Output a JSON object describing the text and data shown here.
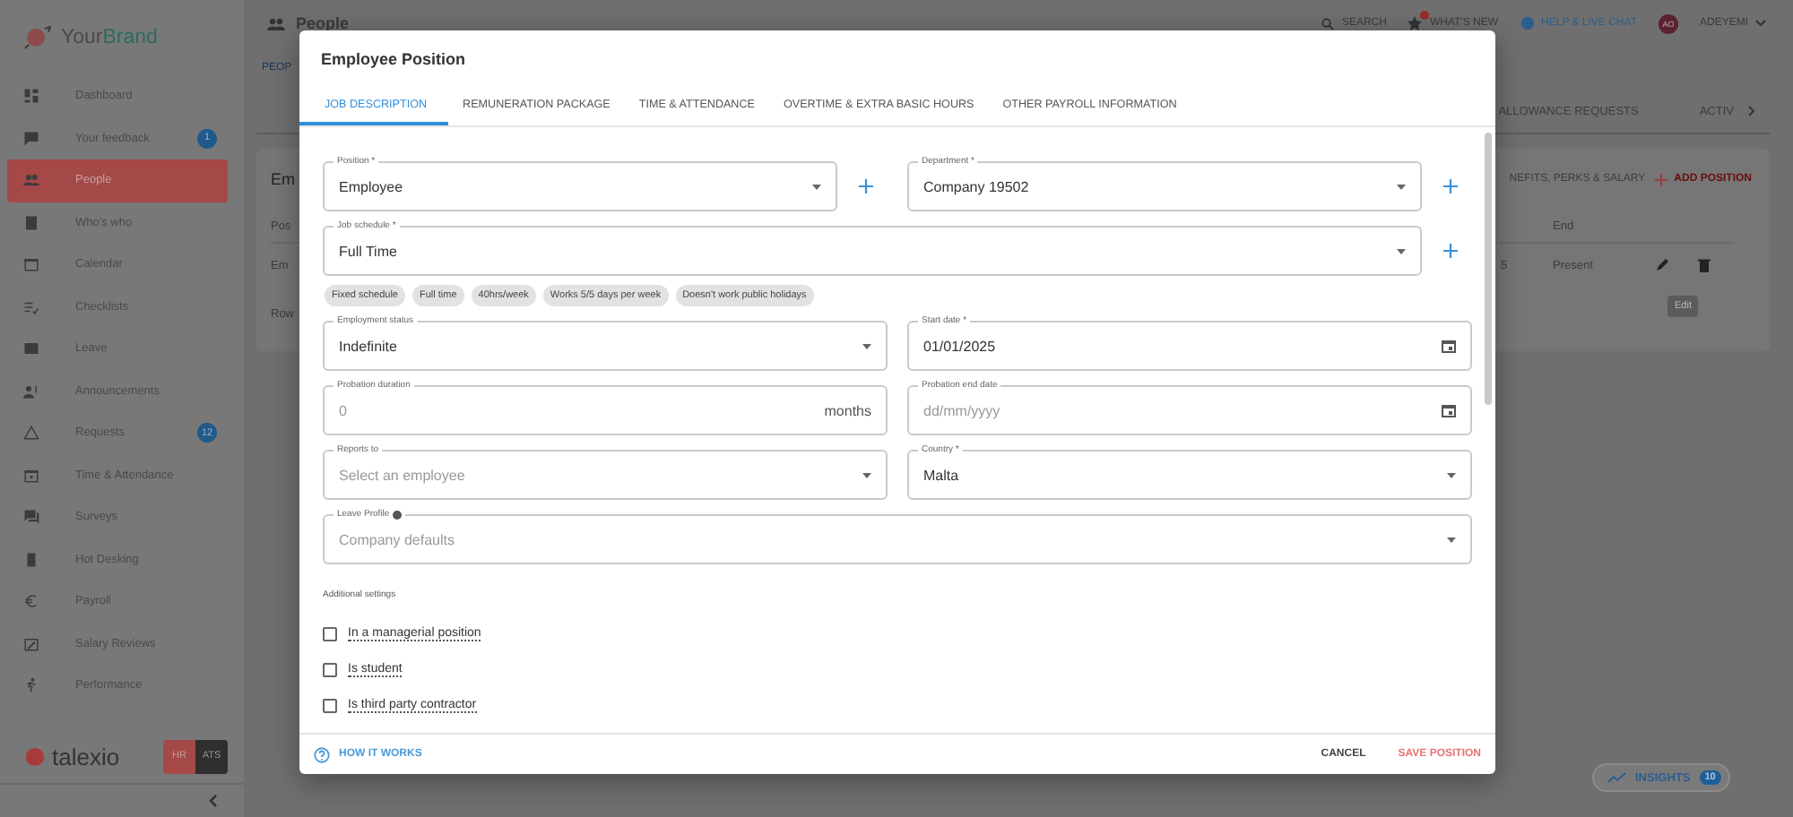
{
  "sidebar": {
    "brand": {
      "first": "Your",
      "second": "Brand"
    },
    "items": [
      {
        "label": "Dashboard",
        "selected": false
      },
      {
        "label": "Your feedback",
        "selected": false,
        "badge": "1"
      },
      {
        "label": "People",
        "selected": true
      },
      {
        "label": "Who's who",
        "selected": false
      },
      {
        "label": "Calendar",
        "selected": false
      },
      {
        "label": "Checklists",
        "selected": false
      },
      {
        "label": "Leave",
        "selected": false
      },
      {
        "label": "Announcements",
        "selected": false
      },
      {
        "label": "Requests",
        "selected": false,
        "badge": "12"
      },
      {
        "label": "Time & Attendance",
        "selected": false
      },
      {
        "label": "Surveys",
        "selected": false
      },
      {
        "label": "Hot Desking",
        "selected": false
      },
      {
        "label": "Payroll",
        "selected": false
      },
      {
        "label": "Salary Reviews",
        "selected": false
      },
      {
        "label": "Performance",
        "selected": false
      }
    ],
    "footer": {
      "logo": "talexio",
      "modes": [
        {
          "label": "HR",
          "selected": true
        },
        {
          "label": "ATS",
          "selected": false
        }
      ]
    }
  },
  "topbar": {
    "title": "People",
    "actions": [
      {
        "kind": "search",
        "label": "SEARCH"
      },
      {
        "kind": "news",
        "label": "WHAT'S NEW",
        "unread": true
      },
      {
        "kind": "help",
        "label": "HELP & LIVE CHAT"
      },
      {
        "kind": "user",
        "avatar": "AO",
        "label": "ADEYEMI"
      }
    ]
  },
  "page": {
    "breadcrumb": "PEOP",
    "tabs": [
      "ALLOWANCE REQUESTS",
      "ACTIV"
    ],
    "card": {
      "title": "Em",
      "section": "NEFITS, PERKS & SALARY",
      "add": "ADD POSITION",
      "columns": [
        "Pos",
        "End"
      ],
      "row": [
        "Em",
        "5",
        "Present"
      ],
      "rows_label": "Row",
      "tooltip": "Edit"
    }
  },
  "insights": {
    "label": "INSIGHTS",
    "count": "10"
  },
  "dialog": {
    "title": "Employee Position",
    "tabs": [
      {
        "label": "JOB DESCRIPTION",
        "selected": true
      },
      {
        "label": "REMUNERATION PACKAGE",
        "selected": false
      },
      {
        "label": "TIME & ATTENDANCE",
        "selected": false
      },
      {
        "label": "OVERTIME & EXTRA BASIC HOURS",
        "selected": false
      },
      {
        "label": "OTHER PAYROLL INFORMATION",
        "selected": false
      }
    ],
    "rows": [
      {
        "fields": [
          {
            "kind": "select",
            "label": "Position *",
            "value": "Employee",
            "add": true
          },
          {
            "kind": "select",
            "label": "Department *",
            "value": "Company 19502",
            "add": true
          }
        ]
      },
      {
        "fields": [
          {
            "kind": "select",
            "label": "Job schedule *",
            "value": "Full Time",
            "add": true
          }
        ],
        "chips": [
          "Fixed schedule",
          "Full time",
          "40hrs/week",
          "Works 5/5 days per week",
          "Doesn't work public holidays"
        ]
      },
      {
        "fields": [
          {
            "kind": "select",
            "label": "Employment status",
            "value": "Indefinite"
          },
          {
            "kind": "date",
            "label": "Start date *",
            "value": "01/01/2025"
          }
        ]
      },
      {
        "fields": [
          {
            "kind": "number",
            "label": "Probation duration",
            "placeholder": "0",
            "suffix": "months"
          },
          {
            "kind": "date",
            "label": "Probation end date",
            "placeholder": "dd/mm/yyyy"
          }
        ]
      },
      {
        "fields": [
          {
            "kind": "select",
            "label": "Reports to",
            "placeholder": "Select an employee"
          },
          {
            "kind": "select",
            "label": "Country *",
            "value": "Malta"
          }
        ]
      },
      {
        "fields": [
          {
            "kind": "select",
            "label": "Leave Profile",
            "placeholder": "Company defaults",
            "info": true
          }
        ]
      }
    ],
    "settings_title": "Additional settings",
    "settings": [
      {
        "label": "In a managerial position",
        "checked": false
      },
      {
        "label": "Is student",
        "checked": false
      },
      {
        "label": "Is third party contractor",
        "checked": false
      }
    ],
    "help": "HOW IT WORKS",
    "actions": [
      {
        "kind": "secondary",
        "label": "CANCEL"
      },
      {
        "kind": "primary",
        "label": "SAVE POSITION"
      }
    ]
  }
}
